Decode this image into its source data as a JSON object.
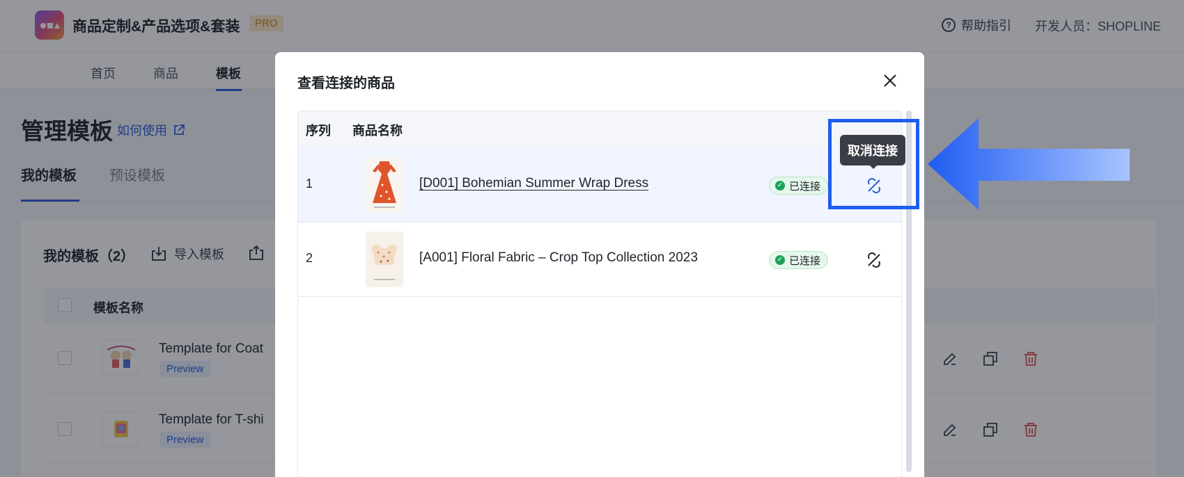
{
  "app": {
    "title": "商品定制&产品选项&套装",
    "badge": "PRO"
  },
  "header": {
    "help": "帮助指引",
    "developer": "开发人员：SHOPLINE"
  },
  "nav": {
    "items": [
      "首页",
      "商品",
      "模板"
    ]
  },
  "page": {
    "title": "管理模板",
    "how_to": "如何使用"
  },
  "tabs": {
    "mine": "我的模板",
    "preset": "预设模板"
  },
  "templates": {
    "title": "我的模板（2）",
    "import": "导入模板",
    "column": "模板名称",
    "rows": [
      {
        "name": "Template for Coat",
        "preview": "Preview"
      },
      {
        "name": "Template for T-shi",
        "preview": "Preview"
      }
    ]
  },
  "modal": {
    "title": "查看连接的商品",
    "columns": {
      "index": "序列",
      "name": "商品名称"
    },
    "rows": [
      {
        "index": "1",
        "name": "[D001] Bohemian Summer Wrap Dress",
        "status": "已连接"
      },
      {
        "index": "2",
        "name": "[A001] Floral Fabric – Crop Top Collection 2023",
        "status": "已连接"
      }
    ],
    "tooltip": "取消连接"
  },
  "colors": {
    "accent": "#2a5bd7",
    "highlight": "#1f5cf2",
    "success": "#1aa35a",
    "delete": "#e5484d"
  }
}
